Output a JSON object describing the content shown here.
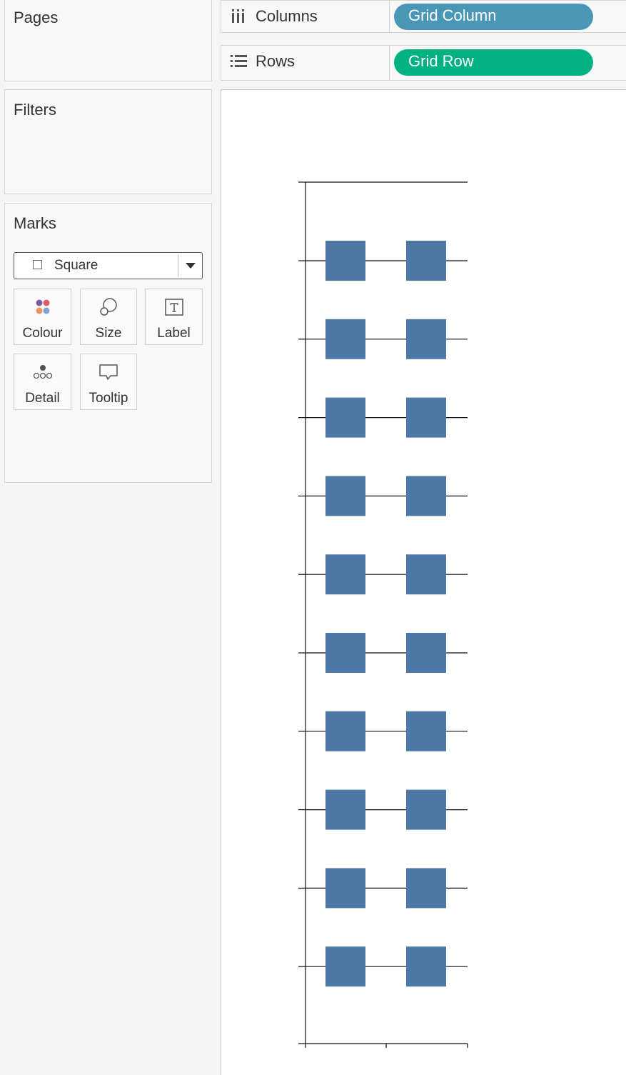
{
  "cards": {
    "pages_title": "Pages",
    "filters_title": "Filters",
    "marks_title": "Marks"
  },
  "marks": {
    "mark_type": "Square",
    "buttons": [
      {
        "label": "Colour",
        "icon": "colour-icon"
      },
      {
        "label": "Size",
        "icon": "size-icon"
      },
      {
        "label": "Label",
        "icon": "label-icon"
      },
      {
        "label": "Detail",
        "icon": "detail-icon"
      },
      {
        "label": "Tooltip",
        "icon": "tooltip-icon"
      }
    ]
  },
  "shelves": {
    "columns_label": "Columns",
    "columns_pill": "Grid Column",
    "rows_label": "Rows",
    "rows_pill": "Grid Row"
  },
  "colors": {
    "columns_pill": "#4a96b7",
    "rows_pill": "#00b182",
    "mark": "#4e79a7"
  },
  "chart_data": {
    "type": "scatter",
    "mark": "square",
    "columns": [
      1,
      2
    ],
    "rows": [
      1,
      2,
      3,
      4,
      5,
      6,
      7,
      8,
      9,
      10
    ],
    "points": [
      {
        "col": 1,
        "row": 1
      },
      {
        "col": 2,
        "row": 1
      },
      {
        "col": 1,
        "row": 2
      },
      {
        "col": 2,
        "row": 2
      },
      {
        "col": 1,
        "row": 3
      },
      {
        "col": 2,
        "row": 3
      },
      {
        "col": 1,
        "row": 4
      },
      {
        "col": 2,
        "row": 4
      },
      {
        "col": 1,
        "row": 5
      },
      {
        "col": 2,
        "row": 5
      },
      {
        "col": 1,
        "row": 6
      },
      {
        "col": 2,
        "row": 6
      },
      {
        "col": 1,
        "row": 7
      },
      {
        "col": 2,
        "row": 7
      },
      {
        "col": 1,
        "row": 8
      },
      {
        "col": 2,
        "row": 8
      },
      {
        "col": 1,
        "row": 9
      },
      {
        "col": 2,
        "row": 9
      },
      {
        "col": 1,
        "row": 10
      },
      {
        "col": 2,
        "row": 10
      }
    ],
    "grid": true,
    "tick_labels_shown": false
  }
}
